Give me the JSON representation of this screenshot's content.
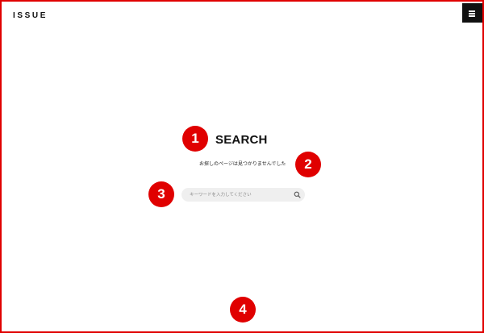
{
  "header": {
    "logo": "ISSUE",
    "menu_icon": "hamburger-menu-icon"
  },
  "main": {
    "title": "SEARCH",
    "message": "お探しのページは見つかりませんでした",
    "search": {
      "placeholder": "キーワードを入力してください",
      "value": "",
      "icon": "search-icon"
    }
  },
  "annotations": {
    "badge_1": "1",
    "badge_2": "2",
    "badge_3": "3",
    "badge_4": "4"
  },
  "colors": {
    "frame": "#e00000",
    "badge": "#e00000",
    "menu_button": "#111111",
    "search_field": "#efefef"
  }
}
